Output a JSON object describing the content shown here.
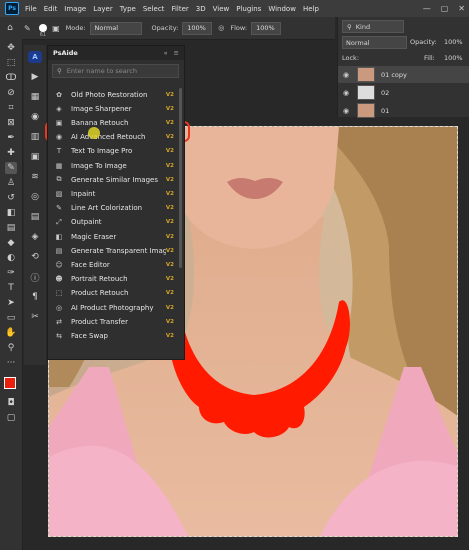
{
  "menubar": {
    "logo": "Ps",
    "items": [
      "File",
      "Edit",
      "Image",
      "Layer",
      "Type",
      "Select",
      "Filter",
      "3D",
      "View",
      "Plugins",
      "Window",
      "Help"
    ]
  },
  "options": {
    "brush_size": "61",
    "mode_label": "Mode:",
    "mode_value": "Normal",
    "opacity_label": "Opacity:",
    "opacity_value": "100%",
    "flow_label": "Flow:",
    "flow_value": "100%"
  },
  "layers": {
    "kind_label": "Kind",
    "blend_mode": "Normal",
    "opacity_label": "Opacity:",
    "opacity_value": "100%",
    "lock_label": "Lock:",
    "fill_label": "Fill:",
    "fill_value": "100%",
    "rows": [
      {
        "name": "01 copy"
      },
      {
        "name": "02"
      },
      {
        "name": "01"
      }
    ]
  },
  "panel": {
    "title": "PsAide",
    "search_placeholder": "Enter name to search",
    "items": [
      {
        "label": "Old Photo Restoration",
        "version": "V2",
        "icon": "restore-icon"
      },
      {
        "label": "Image Sharpener",
        "version": "V2",
        "icon": "sharpen-icon"
      },
      {
        "label": "Banana Retouch",
        "version": "V2",
        "icon": "image-icon"
      },
      {
        "label": "AI Advanced Retouch",
        "version": "V2",
        "icon": "retouch-icon"
      },
      {
        "label": "Text To Image Pro",
        "version": "V2",
        "icon": "text-image-icon"
      },
      {
        "label": "Image To Image",
        "version": "V2",
        "icon": "img2img-icon"
      },
      {
        "label": "Generate Similar Images",
        "version": "V2",
        "icon": "similar-icon"
      },
      {
        "label": "Inpaint",
        "version": "V2",
        "icon": "inpaint-icon"
      },
      {
        "label": "Line Art Colorization",
        "version": "V2",
        "icon": "colorize-icon"
      },
      {
        "label": "Outpaint",
        "version": "V2",
        "icon": "outpaint-icon"
      },
      {
        "label": "Magic Eraser",
        "version": "V2",
        "icon": "eraser-icon"
      },
      {
        "label": "Generate Transparent Image",
        "version": "V2",
        "icon": "transparent-icon"
      },
      {
        "label": "Face Editor",
        "version": "V2",
        "icon": "face-icon"
      },
      {
        "label": "Portrait Retouch",
        "version": "V2",
        "icon": "portrait-icon"
      },
      {
        "label": "Product Retouch",
        "version": "V2",
        "icon": "product-icon"
      },
      {
        "label": "AI Product Photography",
        "version": "V2",
        "icon": "camera-icon"
      },
      {
        "label": "Product Transfer",
        "version": "V2",
        "icon": "transfer-icon"
      },
      {
        "label": "Face Swap",
        "version": "V2",
        "icon": "swap-icon"
      }
    ]
  },
  "colors": {
    "accent_highlight": "#e8361f",
    "mask_red": "#ff1a00",
    "version_badge": "#d7a52a"
  }
}
